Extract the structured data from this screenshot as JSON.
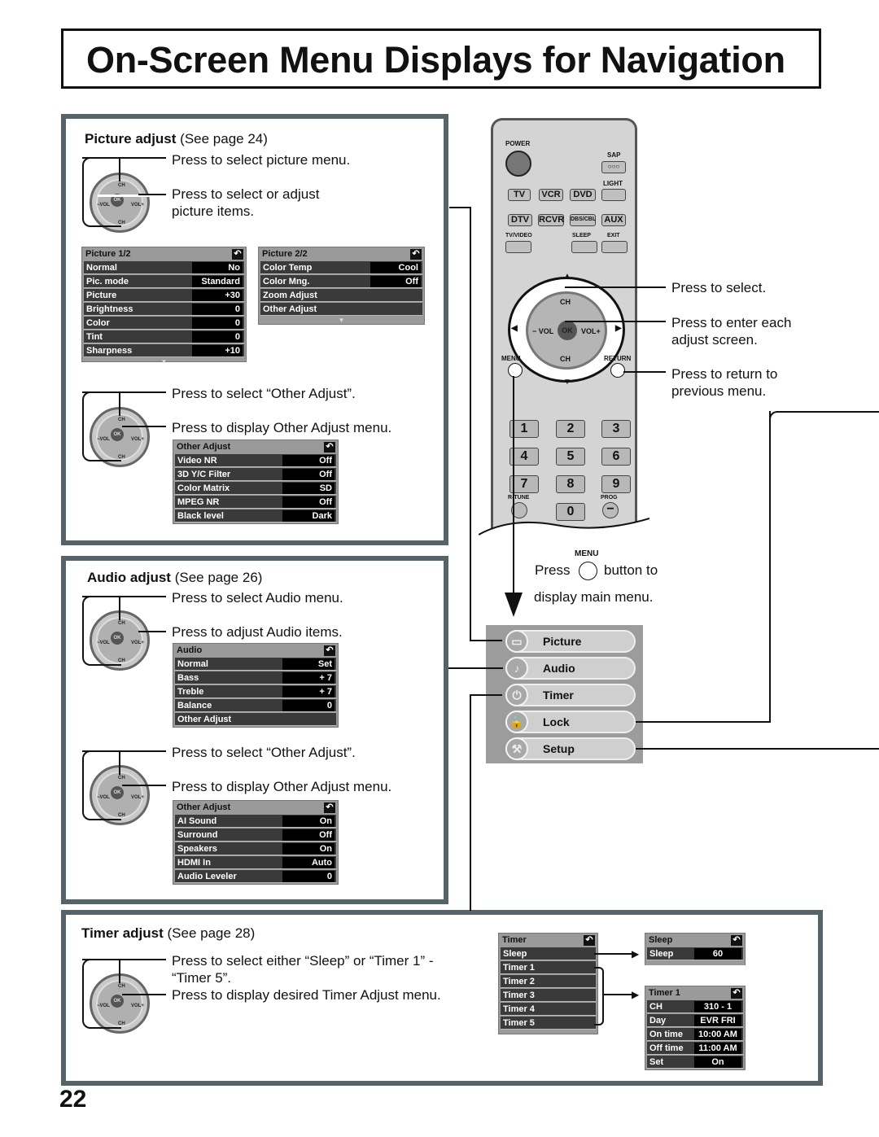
{
  "page": {
    "title": "On-Screen Menu Displays for Navigation",
    "page_number": "22"
  },
  "picture_adjust": {
    "heading": "Picture adjust",
    "see_page": "(See page 24)",
    "instr_select_menu": "Press to select picture menu.",
    "instr_select_adjust_1": "Press to select or adjust",
    "instr_select_adjust_2": "picture items.",
    "instr_select_other": "Press to select “Other Adjust”.",
    "instr_display_other": "Press to display Other Adjust menu.",
    "menu1": {
      "title": "Picture   1/2",
      "rows": [
        {
          "label": "Normal",
          "value": "No"
        },
        {
          "label": "Pic. mode",
          "value": "Standard"
        },
        {
          "label": "Picture",
          "value": "+30"
        },
        {
          "label": "Brightness",
          "value": "0"
        },
        {
          "label": "Color",
          "value": "0"
        },
        {
          "label": "Tint",
          "value": "0"
        },
        {
          "label": "Sharpness",
          "value": "+10"
        }
      ]
    },
    "menu2": {
      "title": "Picture   2/2",
      "rows": [
        {
          "label": "Color Temp",
          "value": "Cool"
        },
        {
          "label": "Color Mng.",
          "value": "Off"
        },
        {
          "label": "Zoom Adjust",
          "value": ""
        },
        {
          "label": "Other Adjust",
          "value": ""
        }
      ]
    },
    "other_menu": {
      "title": "Other Adjust",
      "rows": [
        {
          "label": "Video NR",
          "value": "Off"
        },
        {
          "label": "3D Y/C Filter",
          "value": "Off"
        },
        {
          "label": "Color Matrix",
          "value": "SD"
        },
        {
          "label": "MPEG NR",
          "value": "Off"
        },
        {
          "label": "Black level",
          "value": "Dark"
        }
      ]
    }
  },
  "audio_adjust": {
    "heading": "Audio adjust",
    "see_page": "(See page 26)",
    "instr_select_menu": "Press to select Audio menu.",
    "instr_adjust": "Press to adjust Audio items.",
    "instr_select_other": "Press to select “Other Adjust”.",
    "instr_display_other": "Press to display Other Adjust menu.",
    "menu": {
      "title": "Audio",
      "rows": [
        {
          "label": "Normal",
          "value": "Set"
        },
        {
          "label": "Bass",
          "value": "+ 7"
        },
        {
          "label": "Treble",
          "value": "+ 7"
        },
        {
          "label": "Balance",
          "value": "0"
        },
        {
          "label": "Other Adjust",
          "value": ""
        }
      ]
    },
    "other_menu": {
      "title": "Other Adjust",
      "rows": [
        {
          "label": "AI Sound",
          "value": "On"
        },
        {
          "label": "Surround",
          "value": "Off"
        },
        {
          "label": "Speakers",
          "value": "On"
        },
        {
          "label": "HDMI In",
          "value": "Auto"
        },
        {
          "label": "Audio Leveler",
          "value": "0"
        }
      ]
    }
  },
  "timer_adjust": {
    "heading": "Timer adjust",
    "see_page": "(See page 28)",
    "instr_select_1": "Press to select either “Sleep” or “Timer 1” -",
    "instr_select_2": "“Timer 5”.",
    "instr_display": "Press to display desired Timer Adjust menu.",
    "menu": {
      "title": "Timer",
      "rows": [
        "Sleep",
        "Timer 1",
        "Timer 2",
        "Timer 3",
        "Timer 4",
        "Timer 5"
      ]
    },
    "sleep_menu": {
      "title": "Sleep",
      "rows": [
        {
          "label": "Sleep",
          "value": "60"
        }
      ]
    },
    "timer1_menu": {
      "title": "Timer 1",
      "rows": [
        {
          "label": "CH",
          "value": "310 - 1"
        },
        {
          "label": "Day",
          "value": "EVR FRI"
        },
        {
          "label": "On time",
          "value": "10:00 AM"
        },
        {
          "label": "Off time",
          "value": "11:00 AM"
        },
        {
          "label": "Set",
          "value": "On"
        }
      ]
    }
  },
  "dial": {
    "ch": "CH",
    "vol_minus": "−VOL",
    "vol_plus": "VOL+",
    "ok": "OK"
  },
  "remote": {
    "power": "POWER",
    "sap": "SAP",
    "light": "LIGHT",
    "row1": [
      "TV",
      "VCR",
      "DVD"
    ],
    "row2": [
      "DTV",
      "RCVR",
      "DBS/CBL",
      "AUX"
    ],
    "tv_video": "TV/VIDEO",
    "sleep": "SLEEP",
    "exit": "EXIT",
    "menu": "MENU",
    "return": "RETURN",
    "ch": "CH",
    "ok": "OK",
    "vol_minus": "− VOL",
    "vol_plus": "VOL+",
    "numbers": [
      "1",
      "2",
      "3",
      "4",
      "5",
      "6",
      "7",
      "8",
      "9",
      "0"
    ],
    "r_tune": "R-TUNE",
    "prog": "PROG"
  },
  "remote_notes": {
    "select": "Press to select.",
    "enter_1": "Press to enter each",
    "enter_2": "adjust screen.",
    "return_1": "Press to return to",
    "return_2": "previous menu.",
    "menu_label": "MENU",
    "press": "Press",
    "button_to": "button to",
    "display_main": "display main menu."
  },
  "main_menu": {
    "items": [
      {
        "label": "Picture",
        "icon": "tv-icon"
      },
      {
        "label": "Audio",
        "icon": "music-note-icon"
      },
      {
        "label": "Timer",
        "icon": "power-icon"
      },
      {
        "label": "Lock",
        "icon": "lock-icon"
      },
      {
        "label": "Setup",
        "icon": "wrench-icon"
      }
    ]
  }
}
